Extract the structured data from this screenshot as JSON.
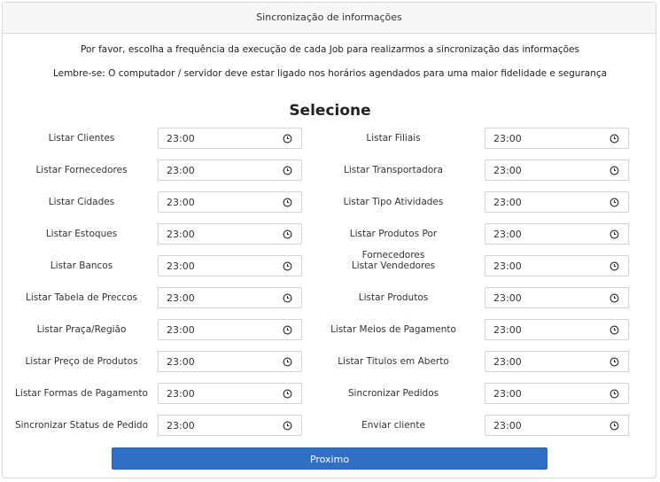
{
  "header": {
    "title": "Sincronização de informações"
  },
  "intro": {
    "line1": "Por favor, escolha a frequência da execução de cada Job para realizarmos a sincronização das informações",
    "line2": "Lembre-se: O computador / servidor deve estar ligado nos horários agendados para uma maior fidelidade e segurança"
  },
  "section_title": "Selecione",
  "left_jobs": [
    {
      "label": "Listar Clientes",
      "time": "23:00"
    },
    {
      "label": "Listar Fornecedores",
      "time": "23:00"
    },
    {
      "label": "Listar Cidades",
      "time": "23:00"
    },
    {
      "label": "Listar Estoques",
      "time": "23:00"
    },
    {
      "label": "Listar Bancos",
      "time": "23:00"
    },
    {
      "label": "Listar Tabela de Preccos",
      "time": "23:00"
    },
    {
      "label": "Listar Praça/Região",
      "time": "23:00"
    },
    {
      "label": "Listar Preço de Produtos",
      "time": "23:00"
    },
    {
      "label": "Listar Formas de Pagamento",
      "time": "23:00"
    },
    {
      "label": "Sincronizar Status de Pedido",
      "time": "23:00"
    }
  ],
  "right_jobs": [
    {
      "label": "Listar Filiais",
      "time": "23:00"
    },
    {
      "label": "Listar Transportadora",
      "time": "23:00"
    },
    {
      "label": "Listar Tipo Atividades",
      "time": "23:00"
    },
    {
      "label": "Listar Produtos Por Fornecedores",
      "time": "23:00"
    },
    {
      "label": "Listar Vendedores",
      "time": "23:00"
    },
    {
      "label": "Listar Produtos",
      "time": "23:00"
    },
    {
      "label": "Listar Meios de Pagamento",
      "time": "23:00"
    },
    {
      "label": "Listar Titulos em Aberto",
      "time": "23:00"
    },
    {
      "label": "Sincronizar Pedidos",
      "time": "23:00"
    },
    {
      "label": "Enviar cliente",
      "time": "23:00"
    }
  ],
  "next_button": "Proximo",
  "colors": {
    "primary": "#2f6fc4",
    "header_bg": "#f7f7f7",
    "border": "#cfd4da"
  }
}
